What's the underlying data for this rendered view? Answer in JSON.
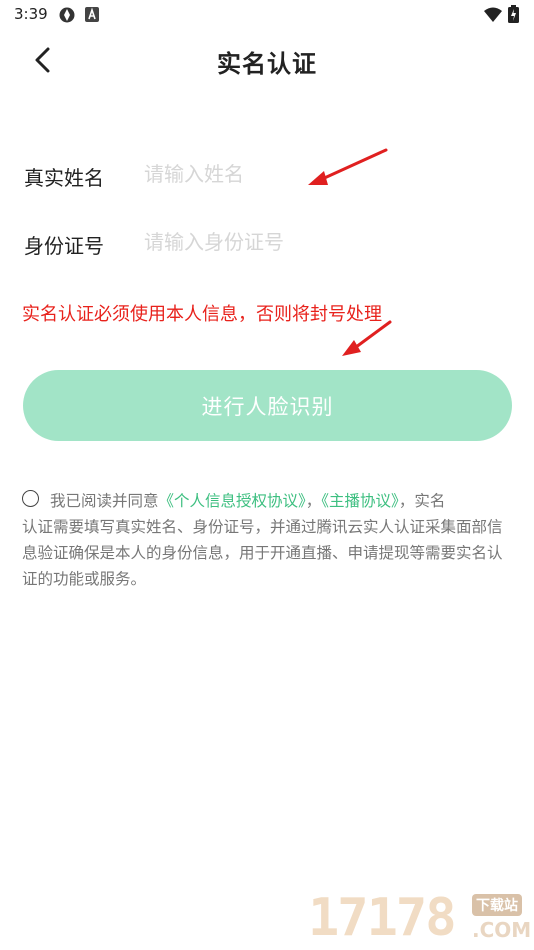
{
  "status_bar": {
    "time": "3:39",
    "left_icons": [
      "sync-icon",
      "notification-a-icon"
    ],
    "right_icons": [
      "wifi-icon",
      "battery-charging-icon"
    ]
  },
  "header": {
    "back_icon": "chevron-left-icon",
    "title": "实名认证"
  },
  "form": {
    "name_label": "真实姓名",
    "name_placeholder": "请输入姓名",
    "name_value": "",
    "id_label": "身份证号",
    "id_placeholder": "请输入身份证号",
    "id_value": ""
  },
  "warning": "实名认证必须使用本人信息，否则将封号处理",
  "face_button_label": "进行人脸识别",
  "agreement": {
    "checked": false,
    "prefix": "我已阅读并同意",
    "link_privacy": "《个人信息授权协议》",
    "separator": "，",
    "link_anchor": "《主播协议》",
    "line1_tail": "，实名",
    "body": "认证需要填写真实姓名、身份证号，并通过腾讯云实人认证采集面部信息验证确保是本人的身份信息，用于开通直播、申请提现等需要实名认证的功能或服务。"
  },
  "watermark": {
    "digits": "17178",
    "badge": "下载站",
    "domain": ".COM"
  },
  "colors": {
    "accent_green": "#3dbf80",
    "button_bg": "#a2e4c7",
    "warning_red": "#e8221c",
    "annotation_arrow": "#e02020"
  }
}
